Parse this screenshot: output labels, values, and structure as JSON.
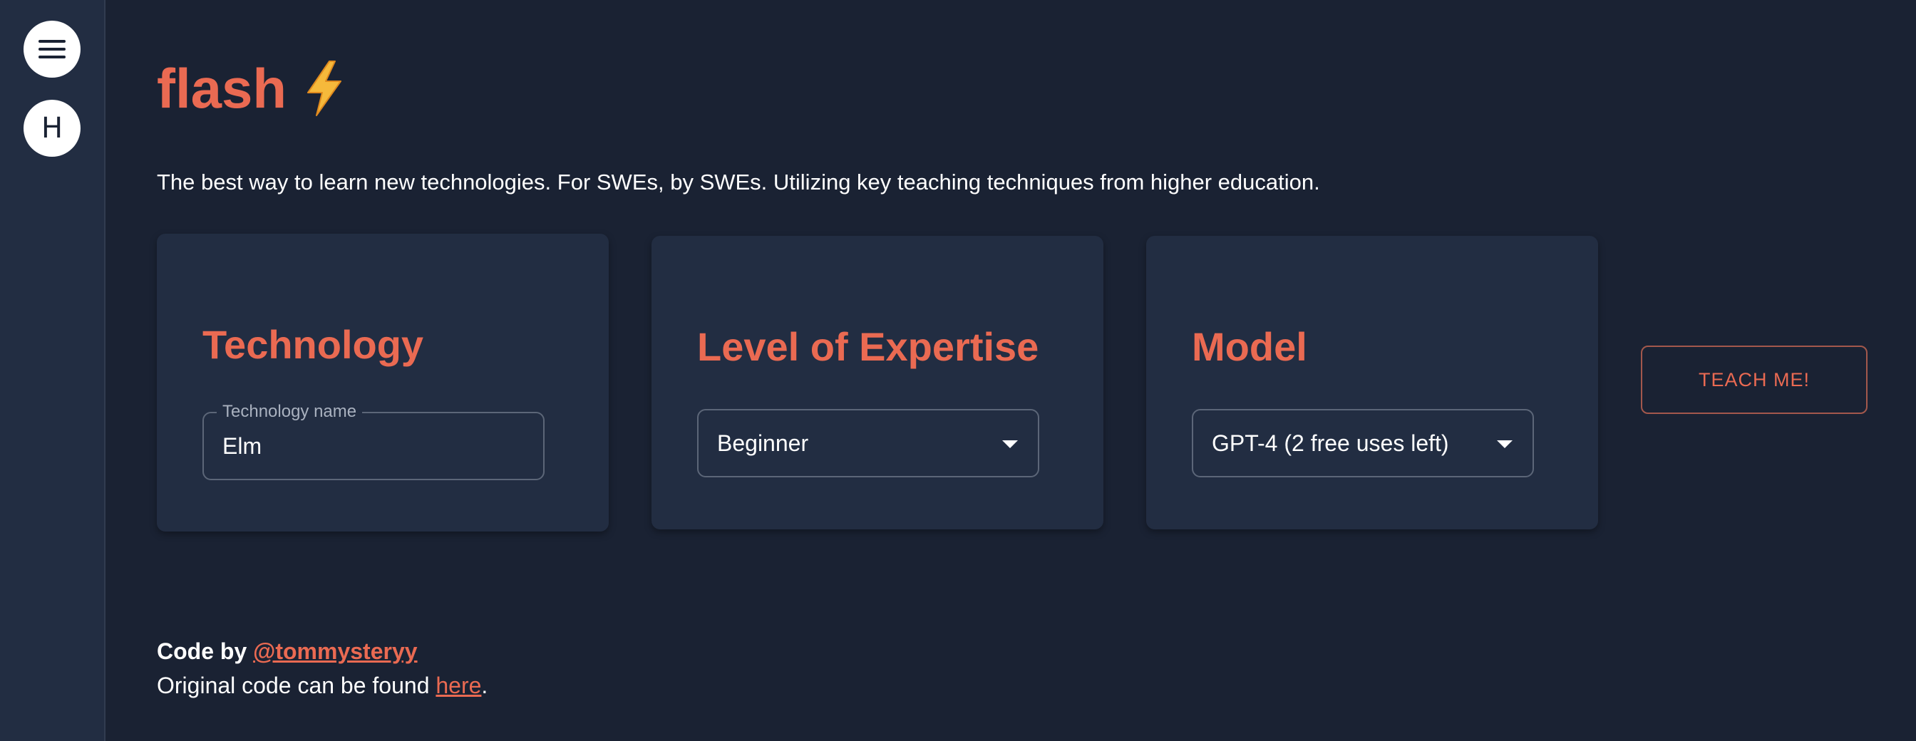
{
  "sidebar": {
    "menu_icon": "hamburger-menu-icon",
    "home_label": "H"
  },
  "header": {
    "title": "flash",
    "title_icon": "lightning-bolt-icon",
    "tagline": "The best way to learn new technologies. For SWEs, by SWEs. Utilizing key teaching techniques from higher education."
  },
  "cards": {
    "technology": {
      "heading": "Technology",
      "field_label": "Technology name",
      "value": "Elm"
    },
    "expertise": {
      "heading": "Level of Expertise",
      "selected": "Beginner"
    },
    "model": {
      "heading": "Model",
      "selected": "GPT-4 (2 free uses left)"
    }
  },
  "actions": {
    "teach_label": "TEACH ME!"
  },
  "footer": {
    "code_by_prefix": "Code by",
    "author_handle": "@tommysteryy",
    "original_prefix": "Original code can be found",
    "here_link": "here",
    "original_suffix": "."
  },
  "colors": {
    "accent": "#ea6a52",
    "background": "#1a2233",
    "card": "#222d42"
  }
}
